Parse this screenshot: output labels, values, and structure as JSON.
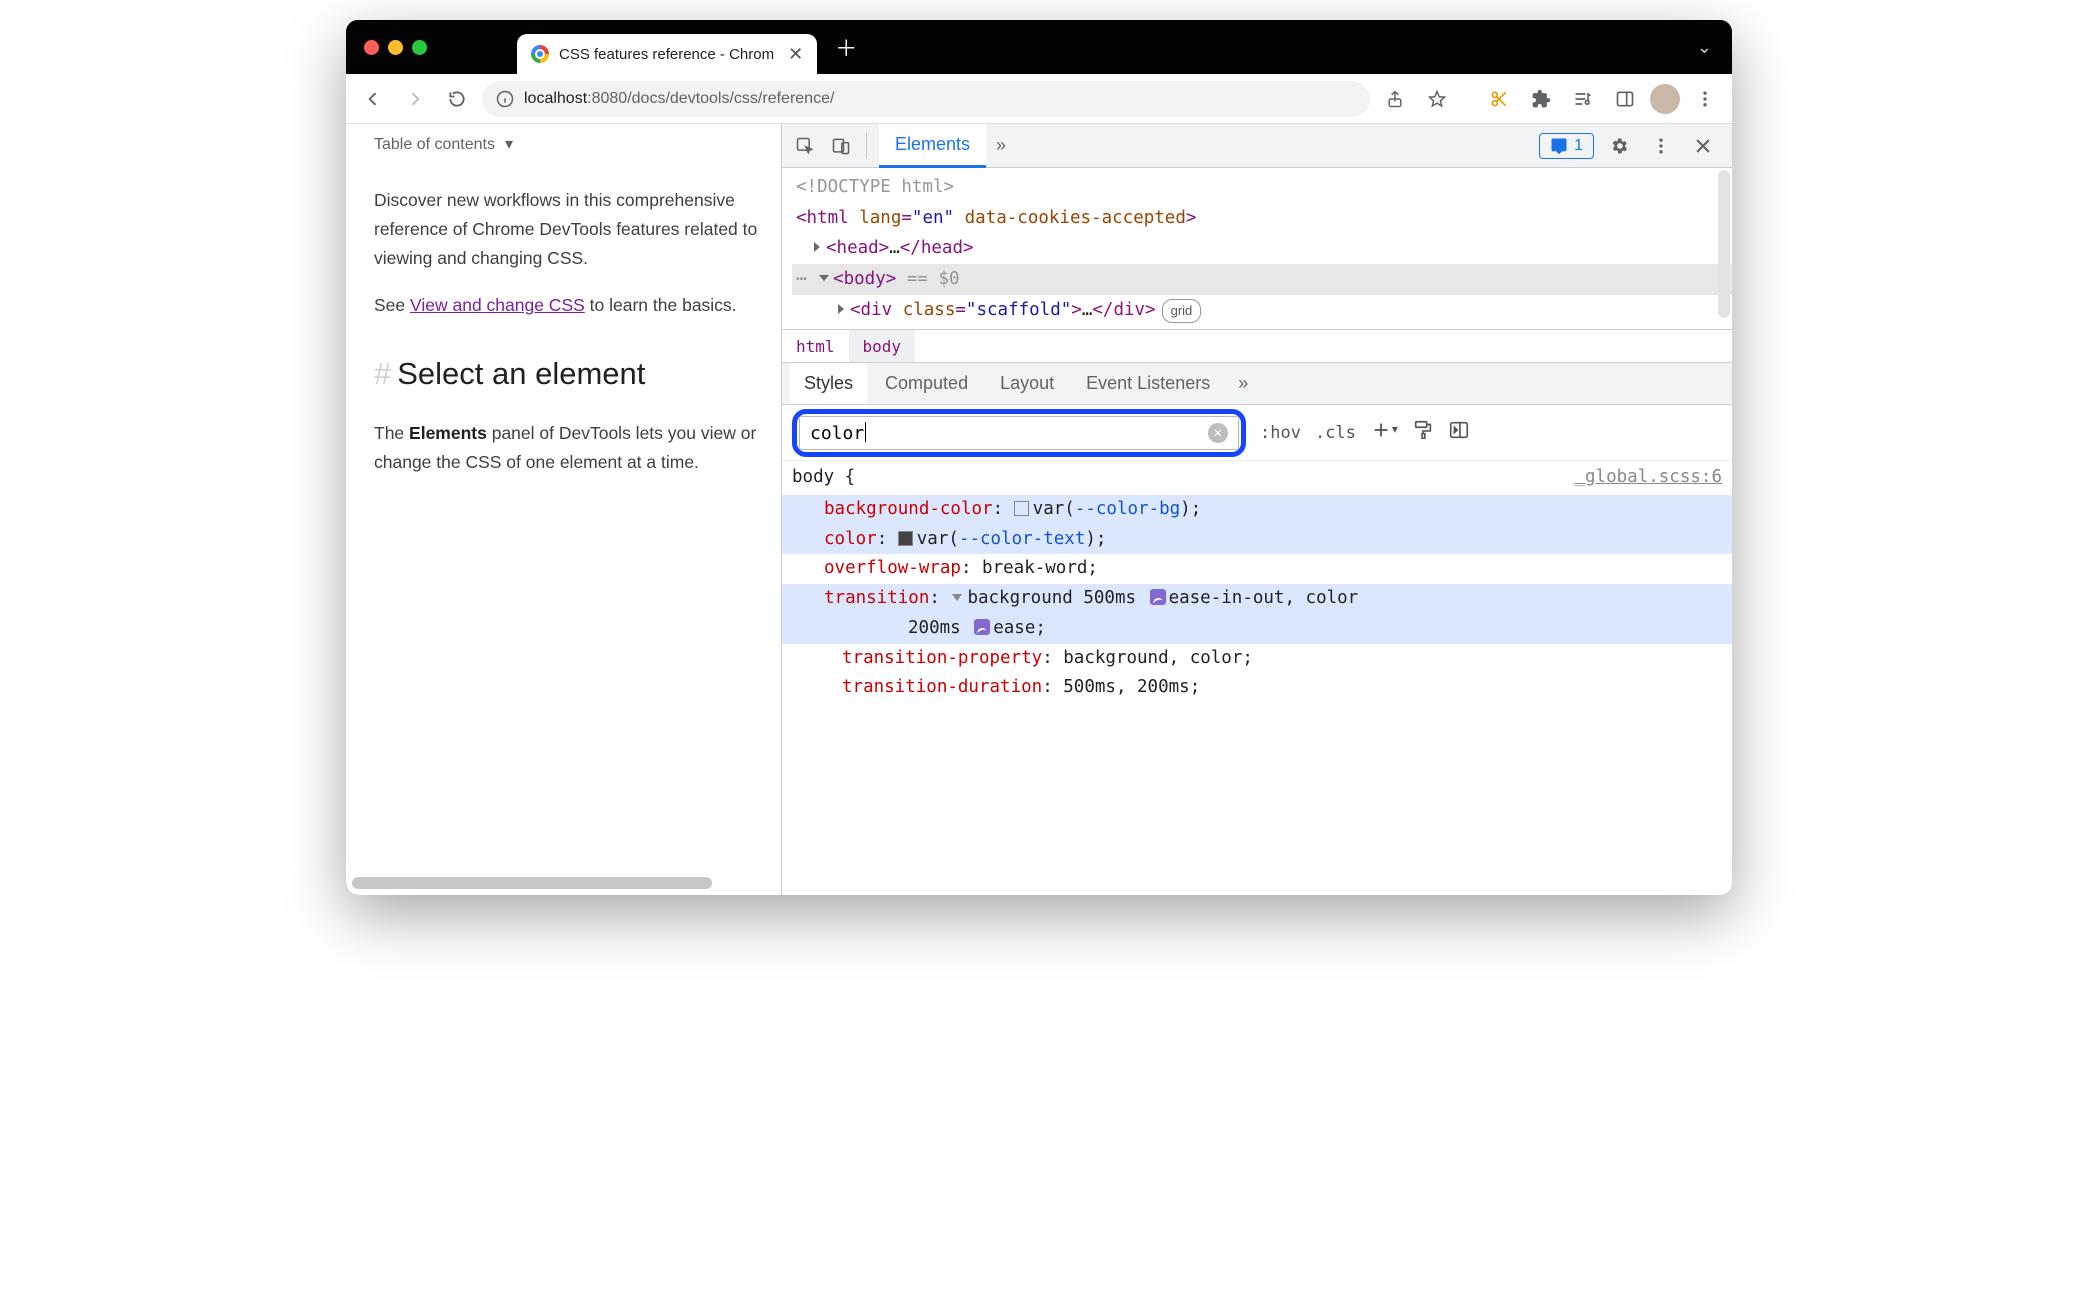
{
  "browser": {
    "tab_title": "CSS features reference - Chrom",
    "url_host": "localhost",
    "url_port": ":8080",
    "url_path": "/docs/devtools/css/reference/"
  },
  "page": {
    "toc_label": "Table of contents",
    "intro": "Discover new workflows in this comprehensive reference of Chrome DevTools features related to viewing and changing CSS.",
    "see_before": "See ",
    "see_link": "View and change CSS",
    "see_after": " to learn the basics.",
    "h2": "Select an element",
    "para2_a": "The ",
    "para2_b": "Elements",
    "para2_c": " panel of DevTools lets you view or change the CSS of one element at a time."
  },
  "devtools": {
    "active_panel": "Elements",
    "issues_count": "1",
    "dom": {
      "doctype": "<!DOCTYPE html>",
      "html_open_a": "<html ",
      "html_lang_n": "lang",
      "html_lang_v": "\"en\"",
      "html_cookies": "data-cookies-accepted",
      "html_open_b": ">",
      "head": "<head>…</head>",
      "body_open": "<body>",
      "body_suffix": " == $0",
      "div_a": "<div ",
      "div_class_n": "class",
      "div_class_v": "\"scaffold\"",
      "div_b": ">…</div>",
      "grid": "grid"
    },
    "crumbs": {
      "c1": "html",
      "c2": "body"
    },
    "subtabs": {
      "t1": "Styles",
      "t2": "Computed",
      "t3": "Layout",
      "t4": "Event Listeners"
    },
    "filter_value": "color",
    "actions": {
      "hov": ":hov",
      "cls": ".cls"
    },
    "rule": {
      "selector": "body {",
      "source": "_global.scss:6",
      "decls": [
        {
          "hl": true,
          "prop": "background-color",
          "raw": "<sw></sw>var(<var>--color-bg</var>);"
        },
        {
          "hl": true,
          "prop": "color",
          "raw": "<swd></swd>var(<var>--color-text</var>);"
        },
        {
          "hl": false,
          "prop": "overflow-wrap",
          "raw": "break-word;"
        },
        {
          "hl": true,
          "prop": "transition",
          "raw": "<tri></tri>background 500ms <cur></cur>ease-in-out, color 200ms <cur></cur>ease;",
          "wrap": true
        },
        {
          "hl": false,
          "nest": true,
          "prop": "transition-property",
          "raw": "background, color;"
        },
        {
          "hl": false,
          "nest": true,
          "prop": "transition-duration",
          "raw": "500ms, 200ms;"
        }
      ]
    }
  }
}
